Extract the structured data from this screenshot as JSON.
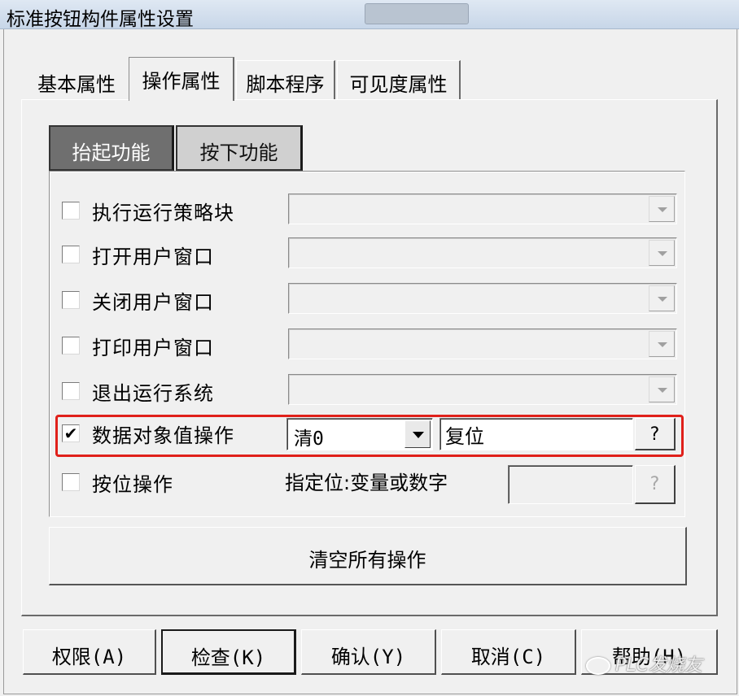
{
  "window": {
    "title": "标准按钮构件属性设置"
  },
  "tabs": [
    {
      "label": "基本属性"
    },
    {
      "label": "操作属性"
    },
    {
      "label": "脚本程序"
    },
    {
      "label": "可见度属性"
    }
  ],
  "subtabs": [
    {
      "label": "抬起功能"
    },
    {
      "label": "按下功能"
    }
  ],
  "options": [
    {
      "label": "执行运行策略块",
      "checked": false,
      "check_mark": ""
    },
    {
      "label": "打开用户窗口",
      "checked": false,
      "check_mark": ""
    },
    {
      "label": "关闭用户窗口",
      "checked": false,
      "check_mark": ""
    },
    {
      "label": "打印用户窗口",
      "checked": false,
      "check_mark": ""
    },
    {
      "label": "退出运行系统",
      "checked": false,
      "check_mark": ""
    }
  ],
  "data_op": {
    "label": "数据对象值操作",
    "checked": true,
    "check_mark": "✔",
    "operation_value": "清0",
    "object_value": "复位",
    "browse_label": "?"
  },
  "bit_op": {
    "label": "按位操作",
    "checked": false,
    "check_mark": "",
    "spec_label": "指定位:变量或数字",
    "browse_label": "?"
  },
  "clear_button": "清空所有操作",
  "buttons": {
    "permissions": "权限(A)",
    "check": "检查(K)",
    "ok": "确认(Y)",
    "cancel": "取消(C)",
    "help": "帮助(H)"
  },
  "watermark": "PLC发烧友",
  "colors": {
    "highlight": "#e0201a",
    "active_subtab": "#6f6f6f"
  }
}
